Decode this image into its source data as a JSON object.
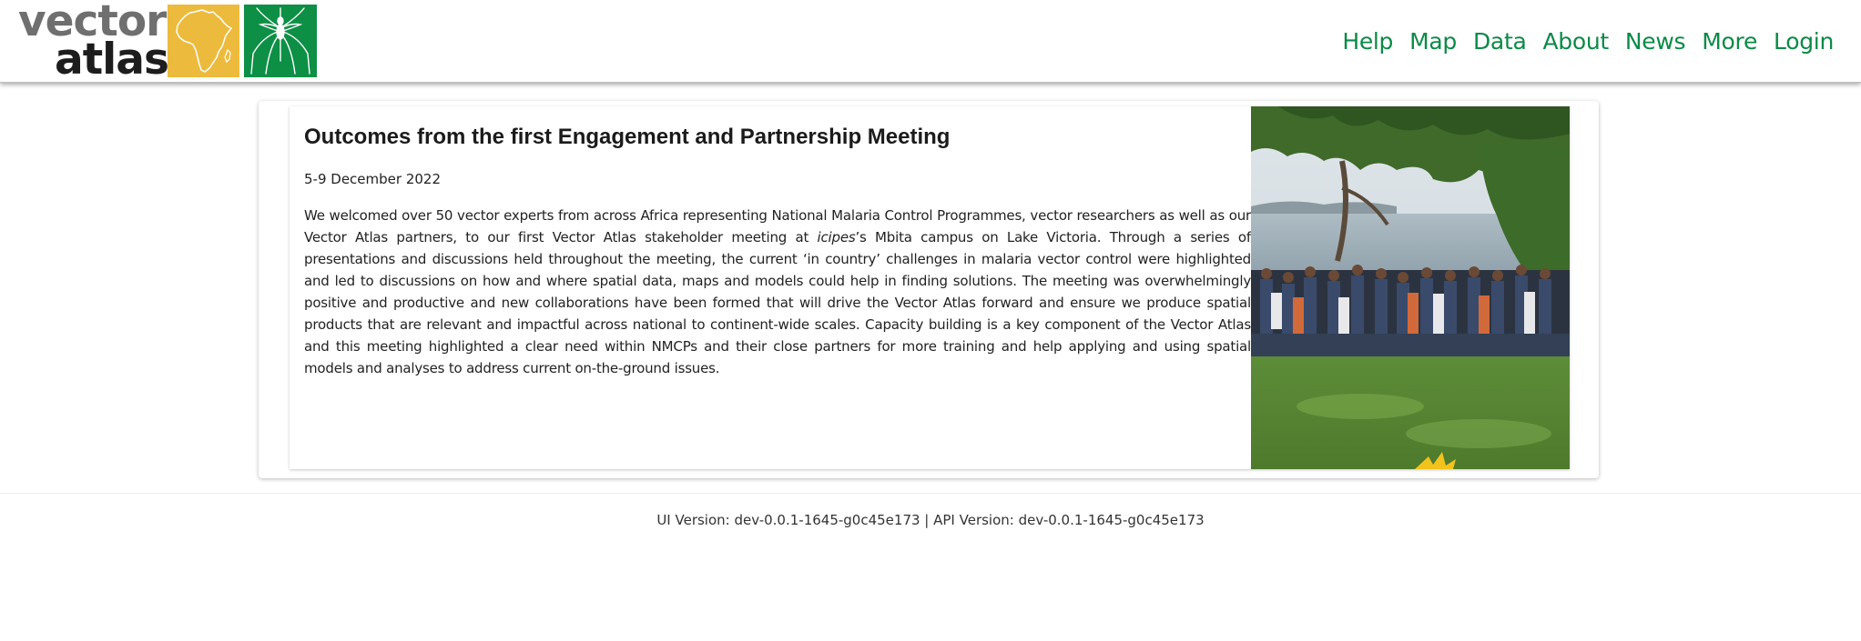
{
  "logo": {
    "line1": "vector",
    "line2": "atlas",
    "colors": {
      "grey": "#6f6f6f",
      "dark": "#1d1d1d",
      "yellow": "#ecbb3d",
      "green": "#0d8f45"
    },
    "icons": [
      "africa-map-icon",
      "mosquito-icon"
    ]
  },
  "nav": {
    "items": [
      {
        "label": "Help"
      },
      {
        "label": "Map"
      },
      {
        "label": "Data"
      },
      {
        "label": "About"
      },
      {
        "label": "News"
      },
      {
        "label": "More"
      },
      {
        "label": "Login"
      }
    ],
    "color": "#0c8a47"
  },
  "article": {
    "title": "Outcomes from the first Engagement and Partnership Meeting",
    "date": "5-9 December 2022",
    "body_before_italic": "We welcomed over 50 vector experts from across Africa  representing National Malaria Control Programmes, vector researchers as well as our Vector Atlas partners, to our first Vector Atlas stakeholder meeting at ",
    "body_italic": "icipes",
    "body_after_italic": "’s Mbita campus on Lake Victoria.  Through a series of presentations and discussions held throughout the meeting, the current ‘in country’ challenges in malaria vector control were highlighted and led to discussions on how and where spatial data, maps and models could help in finding solutions. The meeting was overwhelmingly positive and productive and new collaborations have been formed that will drive the Vector Atlas forward and ensure  we produce spatial products that are relevant and impactful across national to continent-wide scales. Capacity building is a key component of the Vector Atlas and this meeting highlighted a clear need within NMCPs and their close partners for more training and help applying and using spatial models and analyses to address current on-the-ground issues."
  },
  "footer": {
    "text": "UI Version: dev-0.0.1-1645-g0c45e173 | API Version: dev-0.0.1-1645-g0c45e173"
  }
}
